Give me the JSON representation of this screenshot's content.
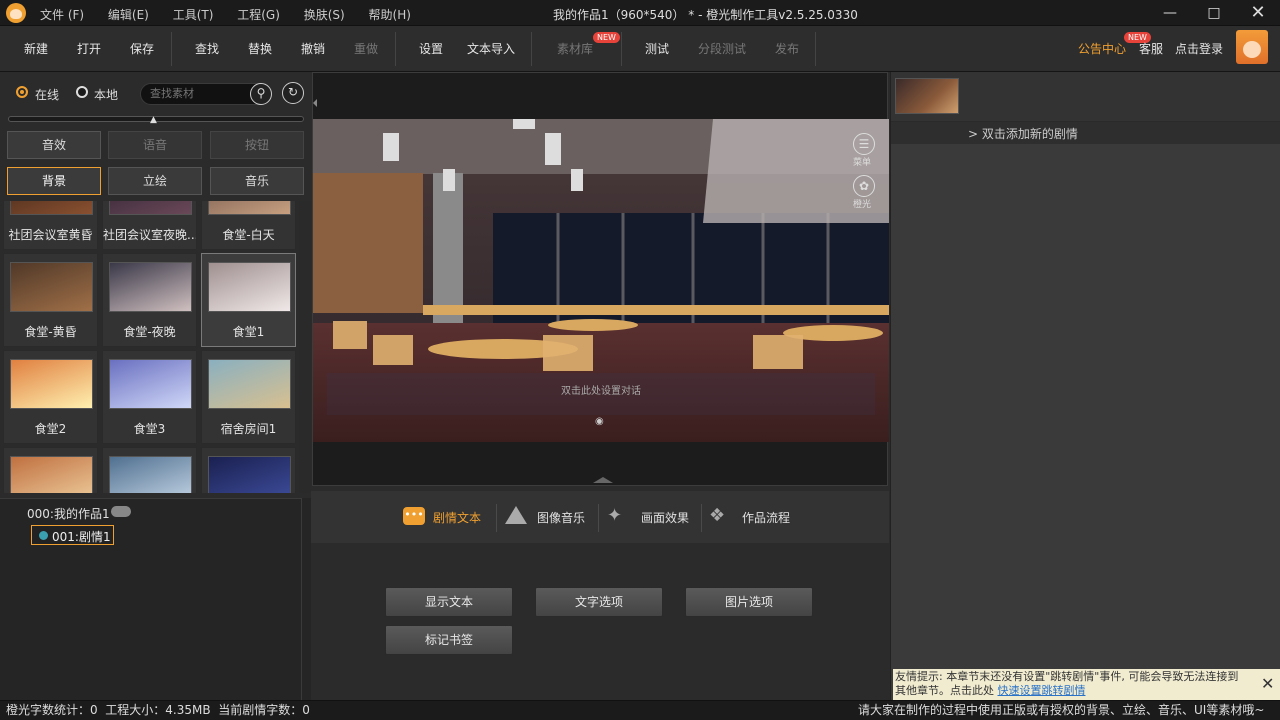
{
  "window": {
    "title": "我的作品1（960*540） * - 橙光制作工具v2.5.25.0330"
  },
  "menu": [
    "文件 (F)",
    "编辑(E)",
    "工具(T)",
    "工程(G)",
    "换肤(S)",
    "帮助(H)"
  ],
  "toolbar": {
    "new": "新建",
    "open": "打开",
    "save": "保存",
    "find": "查找",
    "replace": "替换",
    "undo": "撤销",
    "redo": "重做",
    "settings": "设置",
    "text_import": "文本导入",
    "library": "素材库",
    "library_badge": "NEW",
    "test": "测试",
    "segment_test": "分段测试",
    "publish": "发布",
    "notice": "公告中心",
    "notice_badge": "NEW",
    "service": "客服",
    "login": "点击登录"
  },
  "left": {
    "online": "在线",
    "local": "本地",
    "search_placeholder": "查找素材",
    "categories": [
      "音效",
      "语音",
      "按钮",
      "背景",
      "立绘",
      "音乐"
    ],
    "tiles": [
      {
        "label": "社团会议室黄昏",
        "colors": [
          "#3a2418",
          "#8a5030"
        ]
      },
      {
        "label": "社团会议室夜晚...",
        "colors": [
          "#2a2030",
          "#6a4858"
        ]
      },
      {
        "label": "食堂-白天",
        "colors": [
          "#6a5048",
          "#c8a080"
        ]
      },
      {
        "label": "食堂-黄昏",
        "colors": [
          "#503828",
          "#a07048"
        ]
      },
      {
        "label": "食堂-夜晚",
        "colors": [
          "#3a3848",
          "#d0c0c0"
        ]
      },
      {
        "label": "食堂1",
        "colors": [
          "#a09090",
          "#f0e8e8"
        ]
      },
      {
        "label": "食堂2",
        "colors": [
          "#e08040",
          "#fff0b0"
        ]
      },
      {
        "label": "食堂3",
        "colors": [
          "#6a70c0",
          "#d0d8f8"
        ]
      },
      {
        "label": "宿舍房间1",
        "colors": [
          "#8ab0c0",
          "#d8c090"
        ]
      },
      {
        "label": "",
        "colors": [
          "#c07040",
          "#f0d0a0"
        ]
      },
      {
        "label": "",
        "colors": [
          "#507090",
          "#c8d8e8"
        ]
      },
      {
        "label": "",
        "colors": [
          "#1a2050",
          "#4050a0"
        ]
      }
    ]
  },
  "tree": {
    "root": "000:我的作品1",
    "child": "001:剧情1"
  },
  "stage": {
    "hint": "双击此处设置对话",
    "menu_label": "菜单",
    "orange_label": "橙光"
  },
  "tabs": [
    "剧情文本",
    "图像音乐",
    "画面效果",
    "作品流程"
  ],
  "actions": [
    "显示文本",
    "文字选项",
    "图片选项",
    "标记书签"
  ],
  "right": {
    "add_hint": "> 双击添加新的剧情"
  },
  "warning": {
    "text": "友情提示: 本章节末还没有设置\"跳转剧情\"事件, 可能会导致无法连接到其他章节。点击此处",
    "link": "快速设置跳转剧情"
  },
  "status": {
    "left": "橙光字数统计：0  工程大小：4.35MB  当前剧情字数：0",
    "right": "请大家在制作的过程中使用正版或有授权的背景、立绘、音乐、UI等素材哦~"
  }
}
